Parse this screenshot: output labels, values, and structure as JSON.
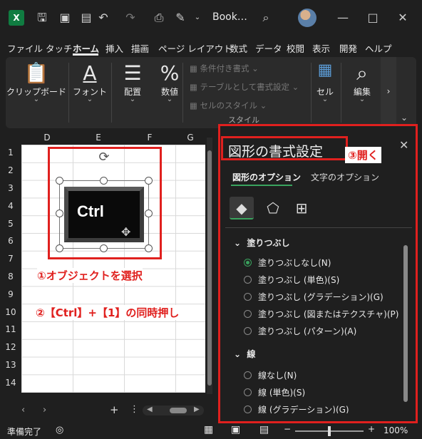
{
  "titlebar": {
    "app_logo": "X",
    "doc_title": "Book…"
  },
  "tabs": [
    "ファイル",
    "タッチ",
    "ホーム",
    "挿入",
    "描画",
    "ページ レイアウト",
    "数式",
    "データ",
    "校閲",
    "表示",
    "開発",
    "ヘルプ"
  ],
  "ribbon": {
    "clipboard": "クリップボード",
    "font": "フォント",
    "alignment": "配置",
    "number": "数値",
    "cond_format": "条件付き書式",
    "table_format": "テーブルとして書式設定",
    "cell_style": "セルのスタイル",
    "style_group": "スタイル",
    "cells": "セル",
    "editing": "編集"
  },
  "grid": {
    "columns": [
      "D",
      "E",
      "F",
      "G"
    ],
    "rows": [
      "1",
      "2",
      "3",
      "4",
      "5",
      "6",
      "7",
      "8",
      "9",
      "10",
      "11",
      "12",
      "13",
      "14"
    ]
  },
  "shape": {
    "label": "Ctrl"
  },
  "annotations": {
    "step1": "①オブジェクトを選択",
    "step2": "②【Ctrl】+【1】の同時押し",
    "step3": "③開く"
  },
  "pane": {
    "title": "図形の書式設定",
    "tab_shape": "図形のオプション",
    "tab_text": "文字のオプション",
    "fill_section": "塗りつぶし",
    "fill_options": [
      "塗りつぶしなし(N)",
      "塗りつぶし (単色)(S)",
      "塗りつぶし (グラデーション)(G)",
      "塗りつぶし (図またはテクスチャ)(P)",
      "塗りつぶし (パターン)(A)"
    ],
    "line_section": "線",
    "line_options": [
      "線なし(N)",
      "線 (単色)(S)",
      "線 (グラデーション)(G)"
    ]
  },
  "status": {
    "ready": "準備完了",
    "zoom": "100%"
  },
  "colors": {
    "accent": "#3aa35e",
    "annotation": "#e0201e",
    "excel_green": "#107c41"
  }
}
